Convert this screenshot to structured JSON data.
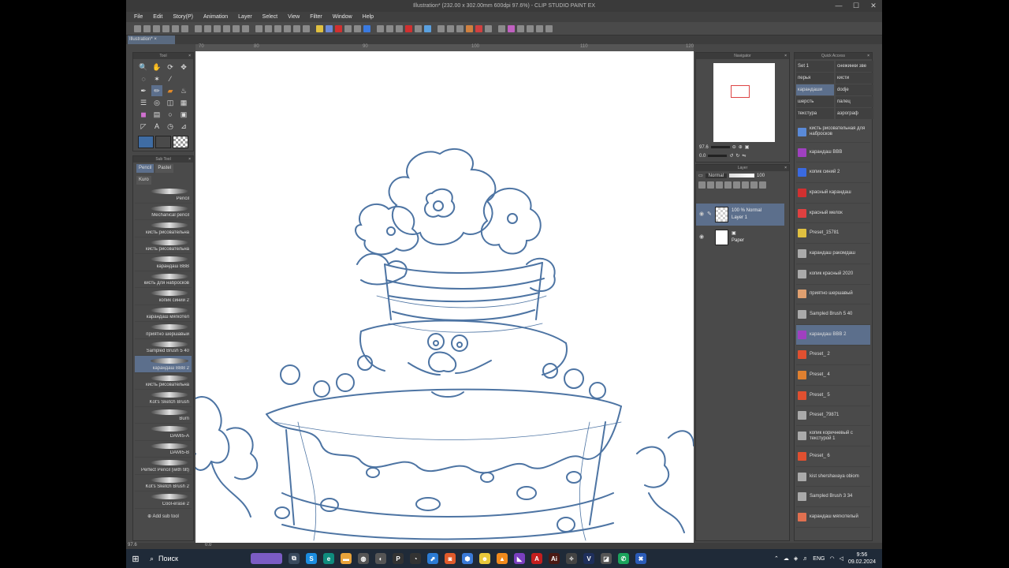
{
  "window": {
    "title": "Illustration* (232.00 x 302.00mm 600dpi 97.6%) - CLIP STUDIO PAINT EX",
    "controls": [
      "—",
      "☐",
      "✕"
    ]
  },
  "menu": [
    "File",
    "Edit",
    "Story(P)",
    "Animation",
    "Layer",
    "Select",
    "View",
    "Filter",
    "Window",
    "Help"
  ],
  "document_tab": "Illustration*",
  "ruler_marks": [
    "70",
    "80",
    "90",
    "100",
    "110",
    "120"
  ],
  "tool_panel": {
    "title": "Tool"
  },
  "sub_tool_panel": {
    "title": "Sub Tool",
    "tabs": [
      "Pencil",
      "Pastel",
      "Kuro"
    ],
    "brushes": [
      "Pencil",
      "Mechanical pencil",
      "кисть рисовательна",
      "кисть рисовательна",
      "карандаш BBB",
      "кисть для набросков",
      "копик синий 2",
      "карандаш мягкотел",
      "приятно шершавый",
      "Sampled Brush 5 40",
      "карандаш BBB 2",
      "кисть рисовательна",
      "Kot's Sketch Brush",
      "Burn",
      "DAMI5-A",
      "DAMI5-B",
      "Perfect Pencil (with tilt)",
      "Kot's Sketch Brush 2",
      "Cool-erase 2"
    ],
    "selected_index": 10,
    "add_label": "Add sub tool"
  },
  "navigator": {
    "title": "Navigator",
    "zoom": "97.6",
    "rotation": "0.0"
  },
  "layer_panel": {
    "title": "Layer",
    "blend_mode": "Normal",
    "opacity": "100",
    "layers": [
      {
        "line1": "100 % Normal",
        "line2": "Layer 1"
      },
      {
        "line1": "",
        "line2": "Paper"
      }
    ]
  },
  "quick_access": {
    "title": "Quick Access",
    "sets": [
      "Set 1",
      "снежинки зве",
      "перья",
      "кисти",
      "карандаши",
      "dodje",
      "шерсть",
      "палец",
      "текстура",
      "аэрограф"
    ],
    "selected_set": 4,
    "items": [
      "кисть рисовательная для набросков",
      "карандаш BBB",
      "копик синий 2",
      "красный карандаш",
      "красный мелок",
      "Preset_15781",
      "карандаш ракомдаш",
      "копик красный 2020",
      "приятно шершавый",
      "Sampled Brush 5 40",
      "карандаш BBB 2",
      "Preset_ 2",
      "Preset_ 4",
      "Preset_ 5",
      "Preset_79871",
      "копик коричневый с текстурой 1",
      "Preset_ 6",
      "kist shershavaya obiom",
      "Sampled Brush 3 34",
      "карандаш мягкотелый"
    ],
    "selected_item": 10
  },
  "status": {
    "zoom": "97.6",
    "angle": "0.0"
  },
  "taskbar": {
    "search_placeholder": "Поиск",
    "lang": "ENG",
    "time": "9:56",
    "date": "09.02.2024"
  },
  "colors": {
    "main_color": "#3f6ca3",
    "sub_color": "#4a4a4a",
    "accent": "#5c6f8c",
    "sketch": "#4d74a3"
  }
}
